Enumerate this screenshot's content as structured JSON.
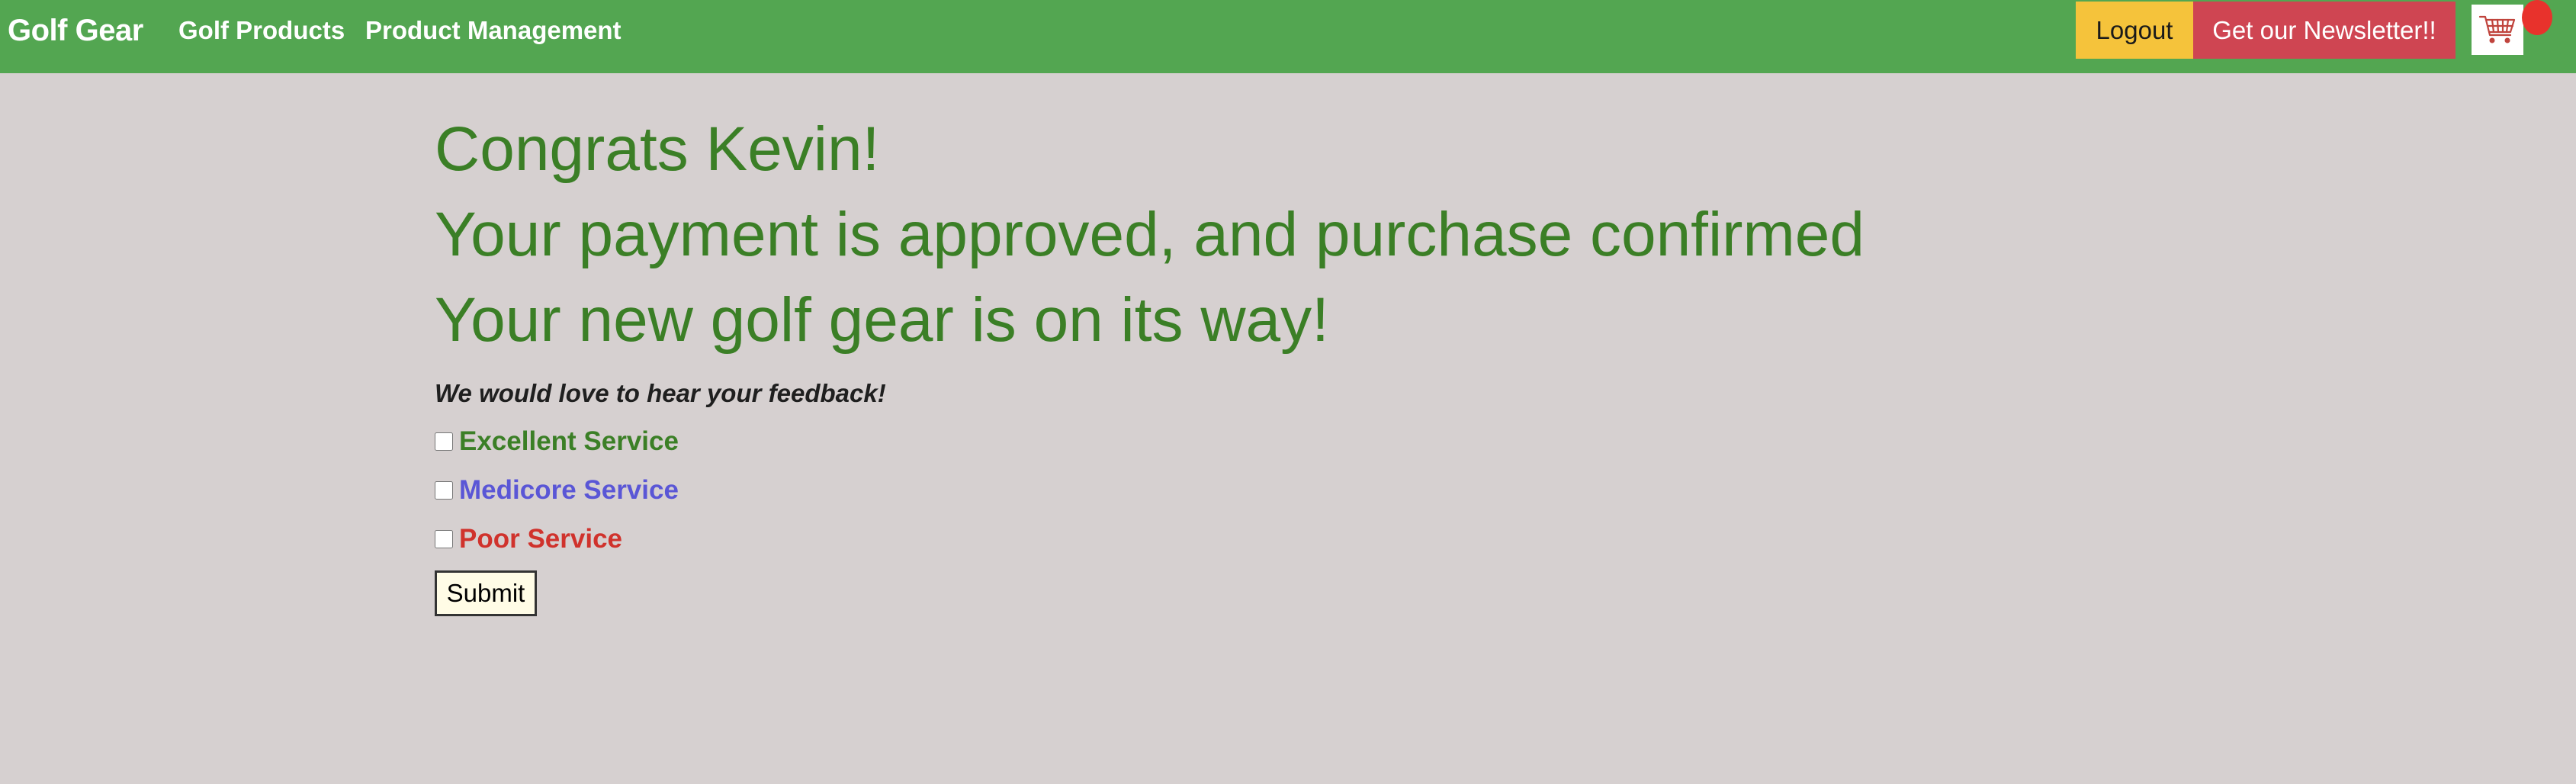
{
  "nav": {
    "brand": "Golf Gear",
    "links": [
      "Golf Products",
      "Product Management"
    ],
    "logout_label": "Logout",
    "newsletter_label": "Get our Newsletter!!",
    "cart_icon": "shopping-cart-icon"
  },
  "main": {
    "headings": [
      "Congrats Kevin!",
      "Your payment is approved, and purchase confirmed",
      "Your new golf gear is on its way!"
    ],
    "feedback_prompt": "We would love to hear your feedback!",
    "options": [
      {
        "label": "Excellent Service",
        "color": "#3b7f26",
        "checked": false
      },
      {
        "label": "Medicore Service",
        "color": "#5a56d6",
        "checked": false
      },
      {
        "label": "Poor Service",
        "color": "#d0322c",
        "checked": false
      }
    ],
    "submit_label": "Submit"
  },
  "colors": {
    "navbar": "#53a651",
    "logout": "#f5c33b",
    "newsletter": "#cf4552",
    "cart_badge": "#e8322c",
    "heading": "#3b7f26",
    "background": "#d6d0d0"
  }
}
